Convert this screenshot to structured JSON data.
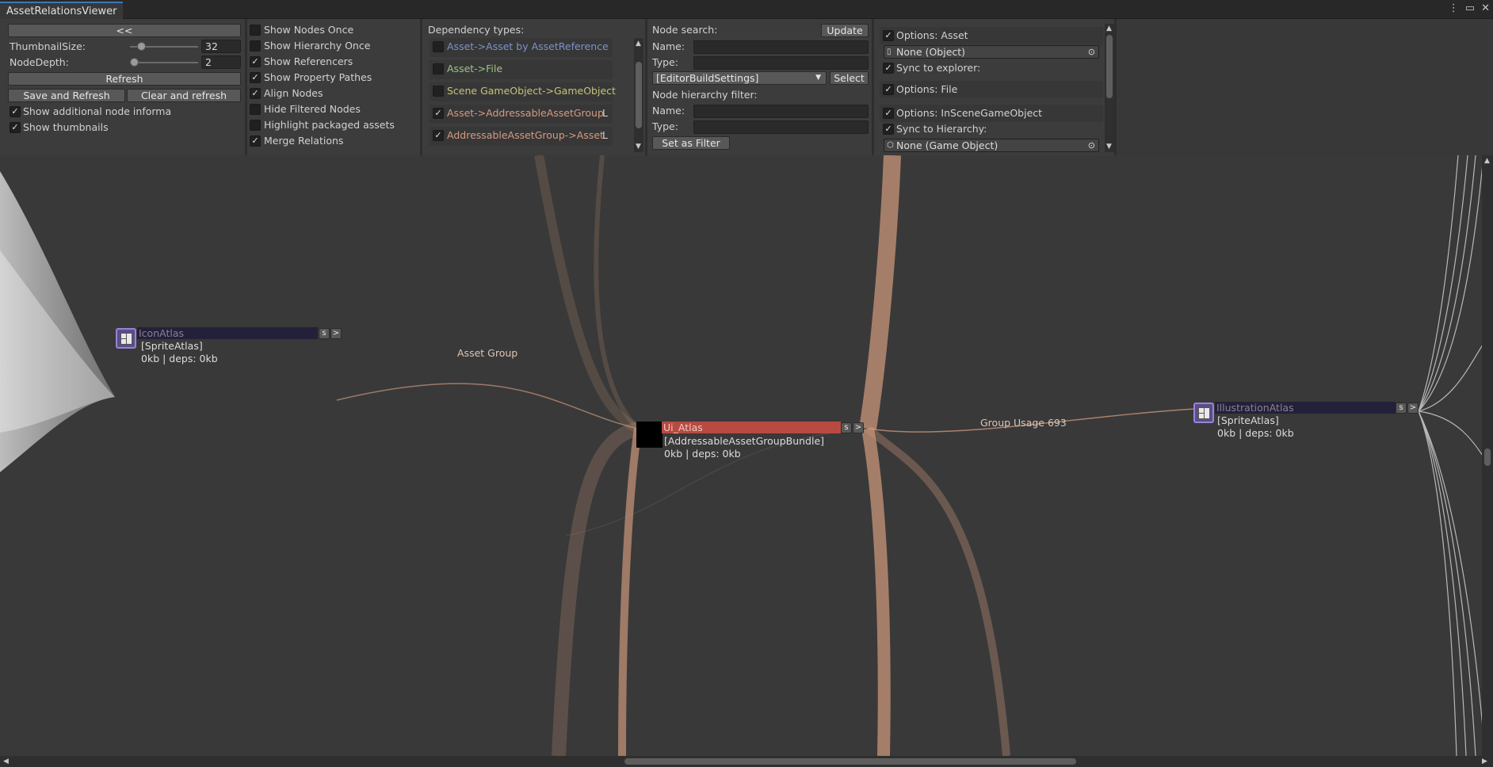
{
  "window": {
    "tab_title": "AssetRelationsViewer",
    "menu_icon": "⋮",
    "maximize_icon": "▭",
    "close_icon": "✕"
  },
  "panel1": {
    "collapse_label": "<<",
    "thumbnail_size_label": "ThumbnailSize:",
    "thumbnail_size_value": "32",
    "node_depth_label": "NodeDepth:",
    "node_depth_value": "2",
    "refresh_label": "Refresh",
    "save_refresh_label": "Save and Refresh",
    "clear_refresh_label": "Clear and refresh",
    "show_additional_label": "Show additional node informa",
    "show_thumbnails_label": "Show thumbnails"
  },
  "panel2": {
    "options": [
      {
        "label": "Show Nodes Once",
        "checked": false
      },
      {
        "label": "Show Hierarchy Once",
        "checked": false
      },
      {
        "label": "Show Referencers",
        "checked": true
      },
      {
        "label": "Show Property Pathes",
        "checked": true
      },
      {
        "label": "Align Nodes",
        "checked": true
      },
      {
        "label": "Hide Filtered Nodes",
        "checked": false
      },
      {
        "label": "Highlight packaged assets",
        "checked": false
      },
      {
        "label": "Merge Relations",
        "checked": true
      }
    ]
  },
  "dependency": {
    "header": "Dependency types:",
    "types": [
      {
        "label": "Asset->Asset by AssetReference",
        "checked": false,
        "color": "#7c93c8",
        "suffix": ""
      },
      {
        "label": "Asset->File",
        "checked": false,
        "color": "#9fc384",
        "suffix": ""
      },
      {
        "label": "Scene GameObject->GameObject",
        "checked": false,
        "color": "#c8c27a",
        "suffix": ""
      },
      {
        "label": "Asset->AddressableAssetGroup",
        "checked": true,
        "color": "#d69a80",
        "suffix": "L"
      },
      {
        "label": "AddressableAssetGroup->Asset",
        "checked": true,
        "color": "#d69a80",
        "suffix": "L"
      }
    ]
  },
  "search": {
    "header": "Node search:",
    "update_label": "Update",
    "name_label": "Name:",
    "type_label": "Type:",
    "dropdown_value": "[EditorBuildSettings]",
    "select_label": "Select",
    "hierarchy_header": "Node hierarchy filter:",
    "filter_name_label": "Name:",
    "filter_type_label": "Type:",
    "set_filter_label": "Set as Filter"
  },
  "options": {
    "asset_label": "Options: Asset",
    "object_field": "None (Object)",
    "sync_explorer_label": "Sync to explorer:",
    "file_label": "Options: File",
    "inscene_label": "Options: InSceneGameObject",
    "sync_hierarchy_label": "Sync to Hierarchy:",
    "gameobject_field": "None (Game Object)"
  },
  "graph": {
    "nodes": {
      "icon_atlas": {
        "name": "IconAtlas",
        "type": "[SpriteAtlas]",
        "size": "0kb | deps: 0kb",
        "btn_s": "s",
        "btn_next": ">"
      },
      "ui_atlas": {
        "name": "Ui_Atlas",
        "type": "[AddressableAssetGroupBundle]",
        "size": "0kb | deps: 0kb",
        "btn_s": "s",
        "btn_next": ">"
      },
      "illustration_atlas": {
        "name": "IllustrationAtlas",
        "type": "[SpriteAtlas]",
        "size": "0kb | deps: 0kb",
        "btn_s": "s",
        "btn_next": ">"
      }
    },
    "edge_labels": {
      "asset_group": "Asset Group",
      "group_usage": "Group Usage 693"
    },
    "colors": {
      "edge": "#c9957a",
      "selected_node": "#b84a42",
      "node_bar": "#23213a"
    }
  }
}
